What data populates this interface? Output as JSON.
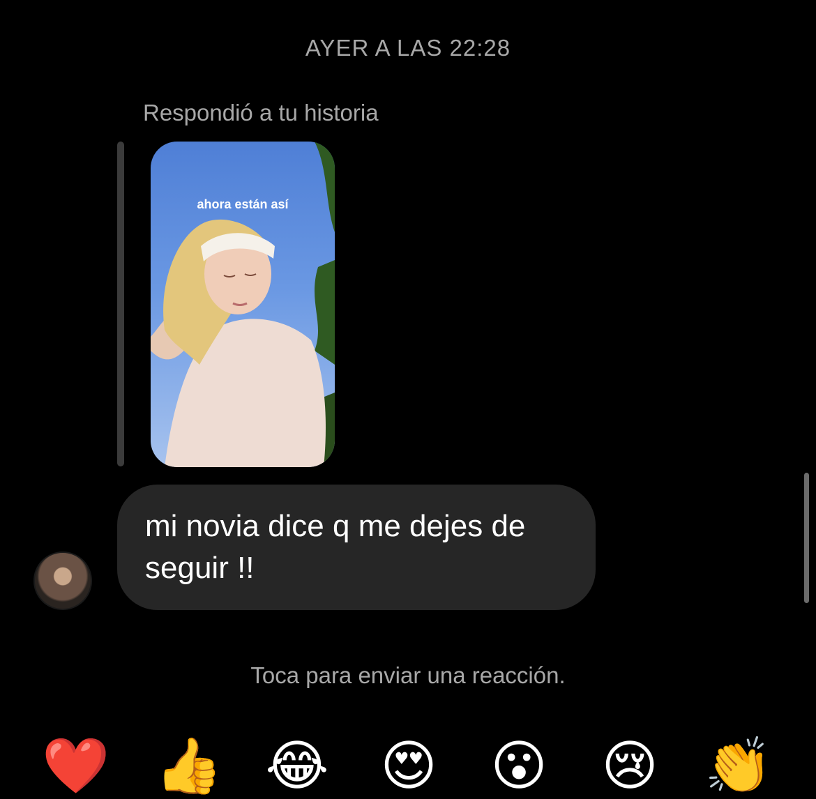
{
  "thread": {
    "timestamp": "AYER A LAS 22:28",
    "reply_label": "Respondió a tu historia",
    "story_caption": "ahora están así",
    "message": "mi novia dice q me dejes de seguir !!",
    "reaction_hint": "Toca para enviar una reacción."
  },
  "reactions": [
    {
      "name": "heart-emoji",
      "glyph": "❤️"
    },
    {
      "name": "thumbs-up-emoji",
      "glyph": "👍"
    },
    {
      "name": "tears-of-joy-emoji",
      "glyph": "😂"
    },
    {
      "name": "heart-eyes-emoji",
      "glyph": "😍"
    },
    {
      "name": "surprised-emoji",
      "glyph": "😮"
    },
    {
      "name": "crying-emoji",
      "glyph": "😢"
    },
    {
      "name": "clapping-emoji",
      "glyph": "👏"
    }
  ]
}
